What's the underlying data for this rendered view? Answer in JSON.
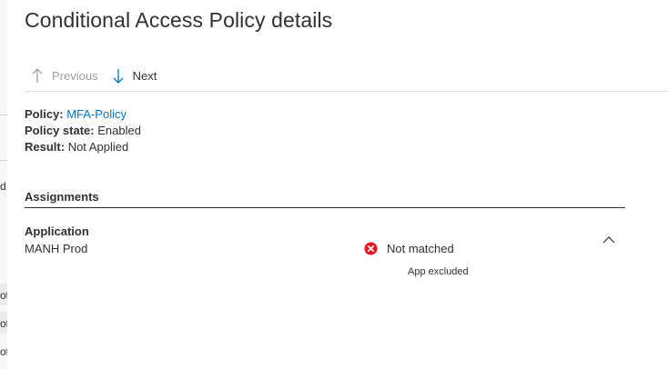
{
  "panel": {
    "title": "Conditional Access Policy details"
  },
  "nav": {
    "previous_label": "Previous",
    "next_label": "Next"
  },
  "policy": {
    "policy_label": "Policy:",
    "policy_value": "MFA-Policy",
    "state_label": "Policy state:",
    "state_value": "Enabled",
    "result_label": "Result:",
    "result_value": "Not Applied"
  },
  "assignments": {
    "heading": "Assignments",
    "application": {
      "label": "Application",
      "name": "MANH Prod",
      "status": "Not matched",
      "status_detail": "App excluded",
      "status_icon": "error-circle-icon",
      "status_color": "#e81123"
    }
  },
  "background_fragments": [
    "d",
    "ot",
    "ot",
    "ot"
  ],
  "colors": {
    "link": "#0078d4",
    "text": "#323130",
    "disabled": "#a19f9d"
  }
}
